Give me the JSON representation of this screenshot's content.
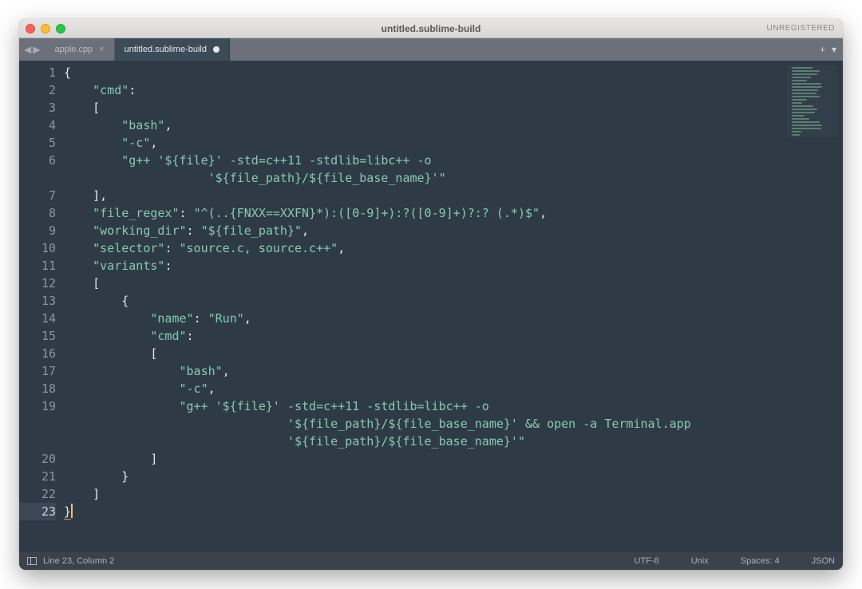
{
  "window": {
    "title": "untitled.sublime-build",
    "registration": "UNREGISTERED"
  },
  "tabs": {
    "back_icon": "◀",
    "forward_icon": "▶",
    "items": [
      {
        "label": "apple.cpp",
        "active": false,
        "dirty": false
      },
      {
        "label": "untitled.sublime-build",
        "active": true,
        "dirty": true
      }
    ],
    "add_icon": "+",
    "menu_icon": "▾"
  },
  "code": {
    "line_count": 23,
    "current_line": 23,
    "lines": [
      {
        "tokens": [
          {
            "t": "punc",
            "v": "{"
          }
        ]
      },
      {
        "indent": 1,
        "tokens": [
          {
            "t": "key",
            "v": "\"cmd\""
          },
          {
            "t": "punc",
            "v": ":"
          }
        ]
      },
      {
        "indent": 1,
        "tokens": [
          {
            "t": "punc",
            "v": "["
          }
        ]
      },
      {
        "indent": 2,
        "tokens": [
          {
            "t": "str",
            "v": "\"bash\""
          },
          {
            "t": "punc",
            "v": ","
          }
        ]
      },
      {
        "indent": 2,
        "tokens": [
          {
            "t": "str",
            "v": "\"-c\""
          },
          {
            "t": "punc",
            "v": ","
          }
        ]
      },
      {
        "indent": 2,
        "tokens": [
          {
            "t": "str",
            "v": "\"g++ '${file}' -std=c++11 -stdlib=libc++ -o\n       '${file_path}/${file_base_name}'\""
          }
        ]
      },
      {
        "indent": 1,
        "tokens": [
          {
            "t": "punc",
            "v": "]"
          },
          {
            "t": "punc",
            "v": ","
          }
        ]
      },
      {
        "indent": 1,
        "tokens": [
          {
            "t": "key",
            "v": "\"file_regex\""
          },
          {
            "t": "punc",
            "v": ": "
          },
          {
            "t": "str",
            "v": "\"^(..{FNXX==XXFN}*):([0-9]+):?([0-9]+)?:? (.*)$\""
          },
          {
            "t": "punc",
            "v": ","
          }
        ]
      },
      {
        "indent": 1,
        "tokens": [
          {
            "t": "key",
            "v": "\"working_dir\""
          },
          {
            "t": "punc",
            "v": ": "
          },
          {
            "t": "str",
            "v": "\"${file_path}\""
          },
          {
            "t": "punc",
            "v": ","
          }
        ]
      },
      {
        "indent": 1,
        "tokens": [
          {
            "t": "key",
            "v": "\"selector\""
          },
          {
            "t": "punc",
            "v": ": "
          },
          {
            "t": "str",
            "v": "\"source.c, source.c++\""
          },
          {
            "t": "punc",
            "v": ","
          }
        ]
      },
      {
        "indent": 1,
        "tokens": [
          {
            "t": "key",
            "v": "\"variants\""
          },
          {
            "t": "punc",
            "v": ":"
          }
        ]
      },
      {
        "indent": 1,
        "tokens": [
          {
            "t": "punc",
            "v": "["
          }
        ]
      },
      {
        "indent": 2,
        "tokens": [
          {
            "t": "punc",
            "v": "{"
          }
        ]
      },
      {
        "indent": 3,
        "tokens": [
          {
            "t": "key",
            "v": "\"name\""
          },
          {
            "t": "punc",
            "v": ": "
          },
          {
            "t": "str",
            "v": "\"Run\""
          },
          {
            "t": "punc",
            "v": ","
          }
        ]
      },
      {
        "indent": 3,
        "tokens": [
          {
            "t": "key",
            "v": "\"cmd\""
          },
          {
            "t": "punc",
            "v": ":"
          }
        ]
      },
      {
        "indent": 3,
        "tokens": [
          {
            "t": "punc",
            "v": "["
          }
        ]
      },
      {
        "indent": 4,
        "tokens": [
          {
            "t": "str",
            "v": "\"bash\""
          },
          {
            "t": "punc",
            "v": ","
          }
        ]
      },
      {
        "indent": 4,
        "tokens": [
          {
            "t": "str",
            "v": "\"-c\""
          },
          {
            "t": "punc",
            "v": ","
          }
        ]
      },
      {
        "indent": 4,
        "tokens": [
          {
            "t": "str",
            "v": "\"g++ '${file}' -std=c++11 -stdlib=libc++ -o\n          '${file_path}/${file_base_name}' && open -a Terminal.app\n          '${file_path}/${file_base_name}'\""
          }
        ]
      },
      {
        "indent": 3,
        "tokens": [
          {
            "t": "punc",
            "v": "]"
          }
        ]
      },
      {
        "indent": 2,
        "tokens": [
          {
            "t": "punc",
            "v": "}"
          }
        ]
      },
      {
        "indent": 1,
        "tokens": [
          {
            "t": "punc",
            "v": "]"
          }
        ]
      },
      {
        "tokens": [
          {
            "t": "punc",
            "v": "}",
            "bracehl": true
          },
          {
            "t": "cursor",
            "v": ""
          }
        ]
      }
    ]
  },
  "statusbar": {
    "position": "Line 23, Column 2",
    "encoding": "UTF-8",
    "line_endings": "Unix",
    "indent": "Spaces: 4",
    "syntax": "JSON"
  }
}
